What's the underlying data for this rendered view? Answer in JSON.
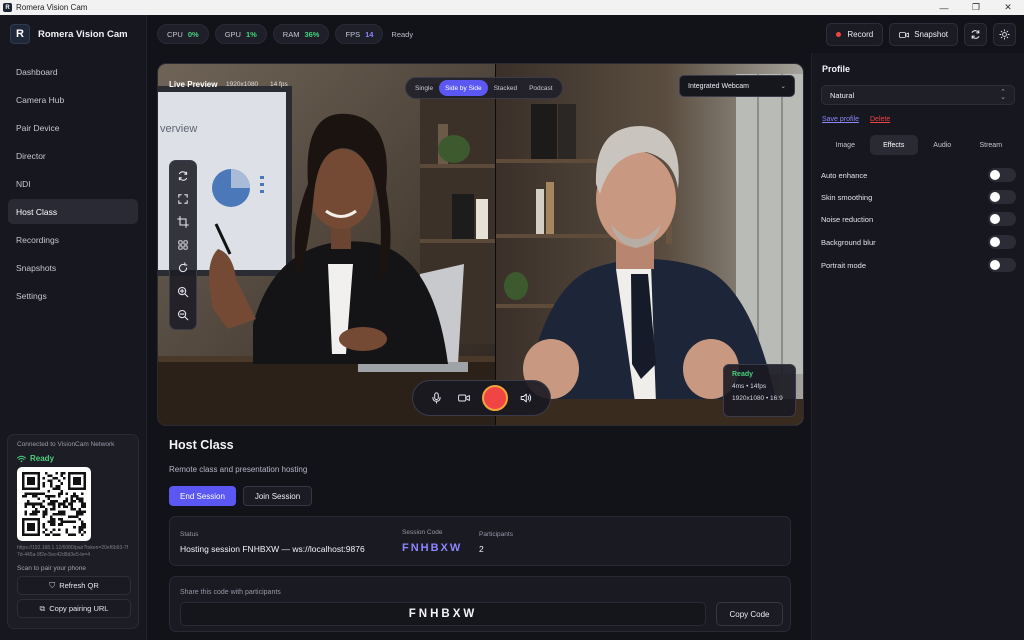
{
  "window": {
    "title": "Romera Vision Cam"
  },
  "brand": {
    "name": "Romera Vision Cam",
    "logo_letter": "R"
  },
  "nav": {
    "items": [
      {
        "label": "Dashboard"
      },
      {
        "label": "Camera Hub"
      },
      {
        "label": "Pair Device"
      },
      {
        "label": "Director"
      },
      {
        "label": "NDI"
      },
      {
        "label": "Host Class",
        "active": true
      },
      {
        "label": "Recordings"
      },
      {
        "label": "Snapshots"
      },
      {
        "label": "Settings"
      }
    ]
  },
  "network": {
    "title": "Connected to VisionCam Network",
    "status": "Ready",
    "url": "https://192.168.1.12/6080/pair?token=20ef6b93-7f7d-445a-9f2e-5ec42d8d3e5-le=4",
    "scan_hint": "Scan to pair your phone",
    "refresh_label": "Refresh QR",
    "copy_label": "Copy pairing URL"
  },
  "stats": [
    {
      "label": "CPU",
      "value": "0%",
      "color": "#45d27e"
    },
    {
      "label": "GPU",
      "value": "1%",
      "color": "#45d27e"
    },
    {
      "label": "RAM",
      "value": "36%",
      "color": "#45d27e"
    },
    {
      "label": "FPS",
      "value": "14",
      "color": "#8c86ff"
    }
  ],
  "status_text": "Ready",
  "actions": {
    "record": "Record",
    "snapshot": "Snapshot"
  },
  "preview": {
    "label": "Live Preview",
    "resolution": "1920x1080",
    "fps": "14 fps",
    "modes": [
      "Single",
      "Side by Side",
      "Stacked",
      "Podcast"
    ],
    "active_mode": "Side by Side",
    "camera": "Integrated Webcam",
    "screen_text": "verview",
    "status_card": {
      "status": "Ready",
      "latency": "4ms • 14fps",
      "format": "1920x1080 • 16:9"
    }
  },
  "host": {
    "title": "Host Class",
    "subtitle": "Remote class and presentation hosting",
    "end_label": "End Session",
    "join_label": "Join Session"
  },
  "session": {
    "status_label": "Status",
    "status_value": "Hosting session FNHBXW — ws://localhost:9876",
    "code_label": "Session Code",
    "code": "FNHBXW",
    "participants_label": "Participants",
    "participants": "2"
  },
  "share": {
    "label": "Share this code with participants",
    "code": "FNHBXW",
    "copy_label": "Copy Code"
  },
  "profile": {
    "title": "Profile",
    "selected": "Natural",
    "save_label": "Save profile",
    "delete_label": "Delete",
    "tabs": [
      "Image",
      "Effects",
      "Audio",
      "Stream"
    ],
    "active_tab": "Effects",
    "toggles": [
      {
        "label": "Auto enhance",
        "on": false
      },
      {
        "label": "Skin smoothing",
        "on": false
      },
      {
        "label": "Noise reduction",
        "on": false
      },
      {
        "label": "Background blur",
        "on": false
      },
      {
        "label": "Portrait mode",
        "on": false
      }
    ]
  },
  "colors": {
    "accent": "#5b57f2",
    "ready": "#47d07a",
    "danger": "#ef4444"
  }
}
